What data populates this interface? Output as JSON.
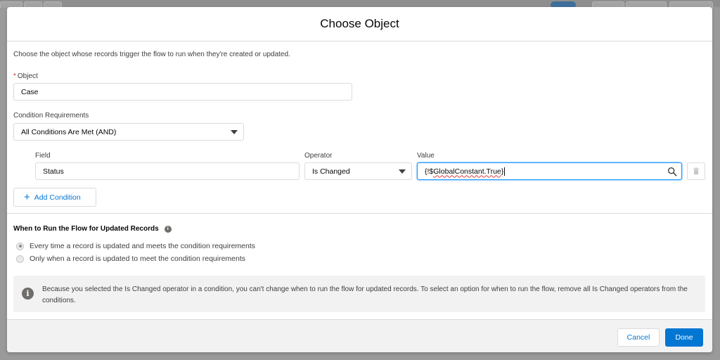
{
  "modal": {
    "title": "Choose Object",
    "description": "Choose the object whose records trigger the flow to run when they're created or updated."
  },
  "object_field": {
    "required_marker": "*",
    "label": "Object",
    "value": "Case"
  },
  "condition_requirements": {
    "label": "Condition Requirements",
    "value": "All Conditions Are Met (AND)"
  },
  "condition_row": {
    "field_label": "Field",
    "field_value": "Status",
    "operator_label": "Operator",
    "operator_value": "Is Changed",
    "value_label": "Value",
    "value_prefix": "{!$",
    "value_main": "GlobalConstant.True",
    "value_suffix": "}"
  },
  "add_condition": {
    "label": "Add Condition"
  },
  "when_to_run": {
    "title": "When to Run the Flow for Updated Records",
    "options": [
      {
        "label": "Every time a record is updated and meets the condition requirements",
        "checked": true
      },
      {
        "label": "Only when a record is updated to meet the condition requirements",
        "checked": false
      }
    ]
  },
  "notice": {
    "text": "Because you selected the Is Changed operator in a condition, you can't change when to run the flow for updated records. To select an option for when to run the flow, remove all Is Changed operators from the conditions."
  },
  "footer": {
    "cancel_label": "Cancel",
    "done_label": "Done"
  },
  "colors": {
    "brand": "#0176d3",
    "focus": "#1b96ff",
    "required": "#c23934"
  }
}
